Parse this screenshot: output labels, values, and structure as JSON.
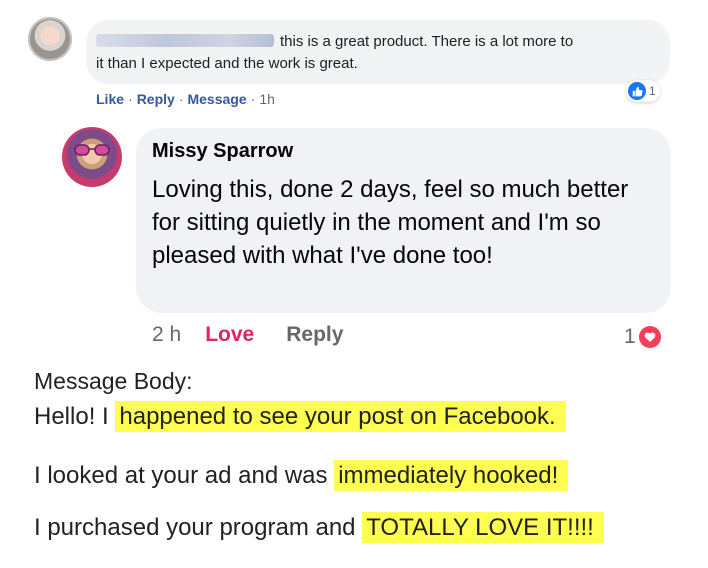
{
  "comment1": {
    "text_line1": "this is a great product. There is a lot more to",
    "text_line2": "it than I expected and the work is great.",
    "actions": {
      "like": "Like",
      "reply": "Reply",
      "message": "Message",
      "sep": "·",
      "time": "1h"
    },
    "reaction_count": "1",
    "reaction_icon": "thumbs-up-icon"
  },
  "comment2": {
    "author": "Missy Sparrow",
    "text": "Loving this, done 2 days, feel so much better for sitting quietly in the moment and I'm so pleased with what I've done too!",
    "actions": {
      "time": "2 h",
      "love": "Love",
      "reply": "Reply"
    },
    "reaction_count": "1",
    "reaction_icon": "heart-icon"
  },
  "message": {
    "label": "Message Body:",
    "line1_plain": "Hello! I ",
    "line1_highlight": "happened to see your post on Facebook.",
    "line2_plain": "I looked at your ad and was ",
    "line2_highlight": "immediately hooked!",
    "line3_plain": "I purchased your program and ",
    "line3_highlight": "TOTALLY LOVE IT!!!!"
  },
  "colors": {
    "facebook_blue": "#1877f2",
    "link_blue": "#385898",
    "love_red": "#e0245e",
    "bubble_grey": "#f0f2f5",
    "highlight_yellow": "#fdfd52"
  }
}
